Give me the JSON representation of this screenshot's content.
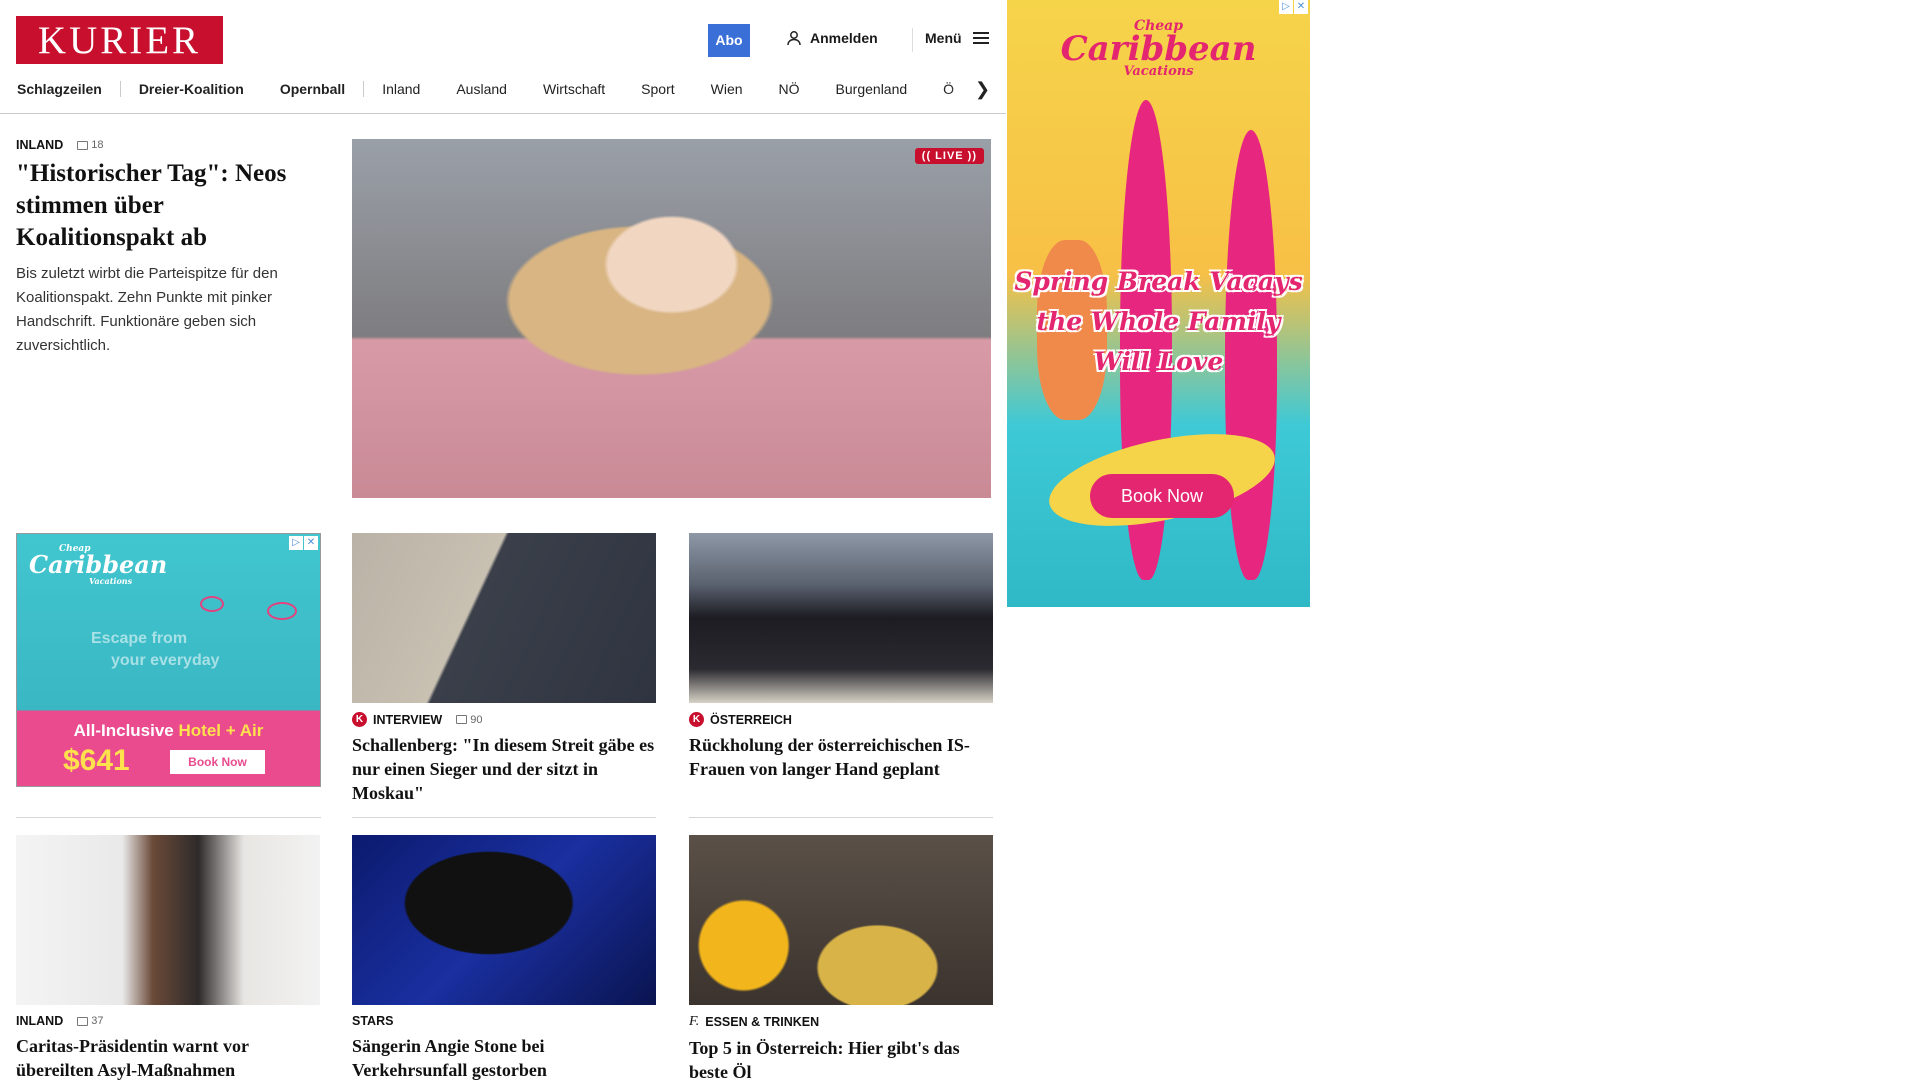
{
  "header": {
    "logo": "KURIER",
    "abo_label": "Abo",
    "login_label": "Anmelden",
    "menu_label": "Menü"
  },
  "nav": {
    "items": [
      "Schlagzeilen",
      "Dreier-Koalition",
      "Opernball",
      "Inland",
      "Ausland",
      "Wirtschaft",
      "Sport",
      "Wien",
      "NÖ",
      "Burgenland",
      "Ö"
    ]
  },
  "lead": {
    "kicker": "INLAND",
    "comments": "18",
    "headline": "\"Historischer Tag\": Neos stimmen über Koalitionspakt ab",
    "teaser": "Bis zuletzt wirbt die Parteispitze für den Koalitionspakt. Zehn Punkte mit pinker Handschrift. Funktionäre geben sich zuversichtlich.",
    "live_badge": "(( LIVE ))"
  },
  "cards": [
    {
      "kicker": "INTERVIEW",
      "comments": "90",
      "headline": "Schallenberg: \"In diesem Streit gäbe es nur einen Sieger und der sitzt in Moskau\""
    },
    {
      "kicker": "ÖSTERREICH",
      "headline": "Rückholung der österreichischen IS-Frauen von langer Hand geplant"
    },
    {
      "kicker": "INLAND",
      "comments": "37",
      "headline": "Caritas-Präsidentin warnt vor übereilten Asyl-Maßnahmen"
    },
    {
      "kicker": "STARS",
      "headline": "Sängerin Angie Stone bei Verkehrsunfall gestorben"
    },
    {
      "kicker": "ESSEN & TRINKEN",
      "headline": "Top 5 in Österreich: Hier gibt's das beste Öl"
    }
  ],
  "ad_big": {
    "brand_line1": "Cheap",
    "brand_line2": "Caribbean",
    "brand_line3": "Vacations",
    "slogan_line1": "Spring Break Vacays",
    "slogan_line2": "the Whole Family",
    "slogan_line3": "Will Love",
    "cta": "Book Now"
  },
  "ad_small": {
    "brand_line1": "Cheap",
    "brand_line2": "Caribbean",
    "brand_line3": "Vacations",
    "escape_line1": "Escape   from",
    "escape_line2": "your   everyday",
    "offer_prefix": "All-Inclusive",
    "offer_highlight": "Hotel + Air",
    "price": "$641",
    "cta": "Book Now"
  },
  "colors": {
    "brand_red": "#c8102e",
    "abo_blue": "#3a6fd8",
    "ad_pink": "#e3266f",
    "ad_teal": "#41c6cf"
  }
}
